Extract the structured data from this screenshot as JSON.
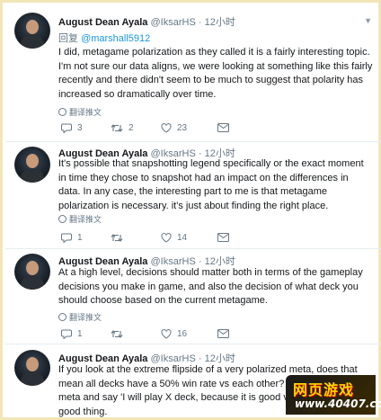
{
  "tweets": [
    {
      "name": "August Dean Ayala",
      "handle": "@IksarHS",
      "dot": "·",
      "time": "12小时",
      "reply_prefix": "回复",
      "reply_mention": "@marshall5912",
      "text": "I did, metagame polarization as they called it is a fairly interesting topic. I'm not sure our data aligns, we were looking at something like this fairly recently and there didn't seem to be much to suggest that polarity has increased so dramatically over time.",
      "translate": "翻译推文",
      "replies": "3",
      "retweets": "2",
      "likes": "23"
    },
    {
      "name": "August Dean Ayala",
      "handle": "@IksarHS",
      "dot": "·",
      "time": "12小时",
      "text": "It's possible that snapshotting legend specifically or the exact moment in time they chose to snapshot had an impact on the differences in data. In any case, the interesting part to me is that metagame polarization is necessary. it's just about finding the right place.",
      "translate": "翻译推文",
      "replies": "1",
      "retweets": "",
      "likes": "14"
    },
    {
      "name": "August Dean Ayala",
      "handle": "@IksarHS",
      "dot": "·",
      "time": "12小时",
      "text": "At a high level, decisions should matter both in terms of the gameplay decisions you make in game, and also the decision of what deck you should choose based on the current metagame.",
      "translate": "翻译推文",
      "replies": "1",
      "retweets": "",
      "likes": "16"
    },
    {
      "name": "August Dean Ayala",
      "handle": "@IksarHS",
      "dot": "·",
      "time": "12小时",
      "text": "If you look at the extreme flipside of a very polarized meta, does that mean all decks have a 50% win rate vs each other? I think if you... the meta and say 'I will play X deck, because it is good vs... you... that is a good thing."
    }
  ],
  "watermark": {
    "cn": "网页游戏",
    "url": "www.40407.com"
  }
}
